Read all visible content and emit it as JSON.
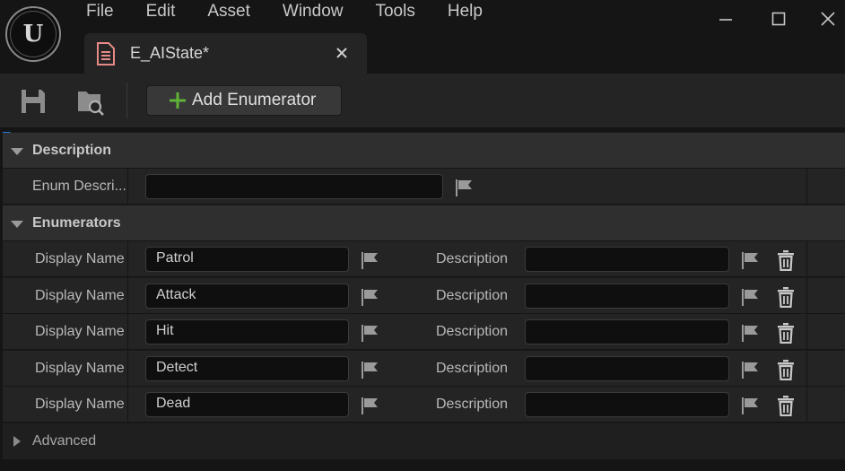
{
  "menu": [
    "File",
    "Edit",
    "Asset",
    "Window",
    "Tools",
    "Help"
  ],
  "tab": {
    "title": "E_AIState*",
    "icon": "enum-asset-icon"
  },
  "window_controls": [
    "minimize-icon",
    "maximize-icon",
    "close-icon"
  ],
  "toolbar": {
    "save_icon": "save-icon",
    "browse_icon": "browse-asset-icon",
    "add_label": "Add Enumerator"
  },
  "description_section": {
    "header": "Description",
    "label": "Enum Descri...",
    "value": ""
  },
  "enumerators_section": {
    "header": "Enumerators",
    "display_name_label": "Display Name",
    "description_label": "Description",
    "items": [
      {
        "display_name": "Patrol",
        "description": ""
      },
      {
        "display_name": "Attack",
        "description": ""
      },
      {
        "display_name": "Hit",
        "description": ""
      },
      {
        "display_name": "Detect",
        "description": ""
      },
      {
        "display_name": "Dead",
        "description": ""
      }
    ]
  },
  "advanced_section": {
    "header": "Advanced"
  },
  "colors": {
    "accent": "#1f7ae0",
    "add_plus": "#5fb336",
    "background": "#151515",
    "panel": "#242424"
  }
}
